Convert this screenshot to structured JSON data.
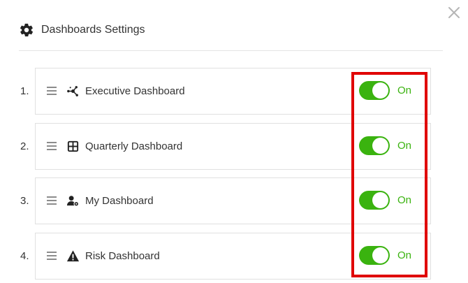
{
  "dialog": {
    "title": "Dashboards Settings",
    "title_icon": "gear-icon",
    "close_icon": "close-icon"
  },
  "dashboards": [
    {
      "index": "1.",
      "name": "Executive Dashboard",
      "icon": "network-icon",
      "state": "On",
      "enabled": true
    },
    {
      "index": "2.",
      "name": "Quarterly Dashboard",
      "icon": "grid-icon",
      "state": "On",
      "enabled": true
    },
    {
      "index": "3.",
      "name": "My Dashboard",
      "icon": "user-settings-icon",
      "state": "On",
      "enabled": true
    },
    {
      "index": "4.",
      "name": "Risk Dashboard",
      "icon": "warning-icon",
      "state": "On",
      "enabled": true
    }
  ],
  "colors": {
    "toggle_on": "#3ab30f",
    "highlight": "#e00000"
  }
}
